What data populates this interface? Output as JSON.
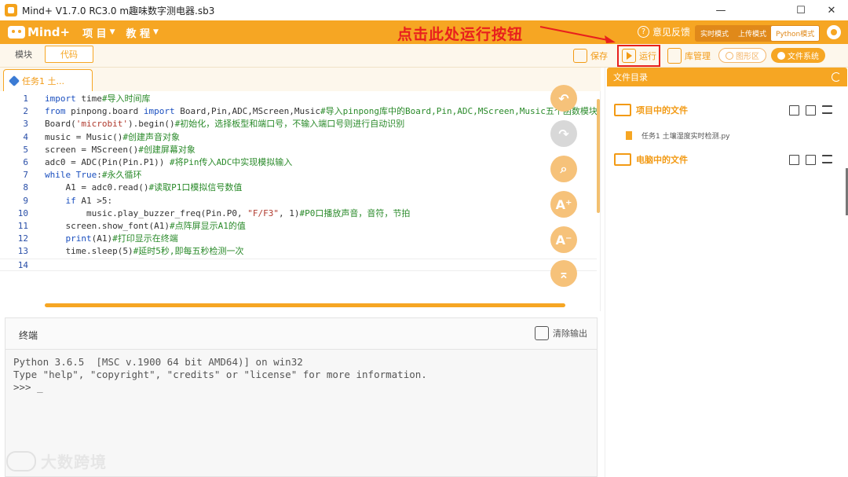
{
  "window": {
    "title": "Mind+ V1.7.0 RC3.0   m趣味数字测电器.sb3",
    "minimize": "—",
    "maximize": "☐",
    "close": "✕"
  },
  "menubar": {
    "logo": "Mind+",
    "menus": [
      {
        "label": "项 目",
        "caret": "▼"
      },
      {
        "label": "教 程",
        "caret": "▼"
      }
    ],
    "annotation": "点击此处运行按钮",
    "feedback": "意见反馈",
    "modes": [
      {
        "label": "实时模式",
        "active": false
      },
      {
        "label": "上传模式",
        "active": false
      },
      {
        "label": "Python模式",
        "active": true
      }
    ]
  },
  "toolbar": {
    "tabs": [
      {
        "label": "模块"
      },
      {
        "label": "代码"
      }
    ],
    "save": "保存",
    "run": "运行",
    "library": "库管理",
    "graph": "图形区",
    "filesystem": "文件系统"
  },
  "editor": {
    "file_tab": "任务1 土...",
    "lines": [
      {
        "n": "1",
        "text": "import time#导入时间库"
      },
      {
        "n": "2",
        "text": "from pinpong.board import Board,Pin,ADC,MScreen,Music#导入pinpong库中的Board,Pin,ADC,MScreen,Music五个函数模块"
      },
      {
        "n": "3",
        "text": "Board('microbit').begin()#初始化，选择板型和端口号，不输入端口号则进行自动识别"
      },
      {
        "n": "4",
        "text": "music = Music()#创建声音对象"
      },
      {
        "n": "5",
        "text": "screen = MScreen()#创建屏幕对象"
      },
      {
        "n": "6",
        "text": "adc0 = ADC(Pin(Pin.P1)) #将Pin传入ADC中实现模拟输入"
      },
      {
        "n": "7",
        "text": "while True:#永久循环"
      },
      {
        "n": "8",
        "text": "    A1 = adc0.read()#读取P1口模拟信号数值"
      },
      {
        "n": "9",
        "text": "    if A1 >5:"
      },
      {
        "n": "10",
        "text": "        music.play_buzzer_freq(Pin.P0, \"F/F3\", 1)#P0口播放声音，音符，节拍"
      },
      {
        "n": "11",
        "text": "    screen.show_font(A1)#点阵屏显示A1的值"
      },
      {
        "n": "12",
        "text": "    print(A1)#打印显示在终端"
      },
      {
        "n": "13",
        "text": "    time.sleep(5)#延时5秒,即每五秒检测一次"
      },
      {
        "n": "14",
        "text": ""
      }
    ],
    "side_buttons": [
      {
        "icon": "undo-icon",
        "glyph": "↶",
        "enabled": true
      },
      {
        "icon": "redo-icon",
        "glyph": "↷",
        "enabled": false
      },
      {
        "icon": "search-icon",
        "glyph": "⌕",
        "enabled": true
      },
      {
        "icon": "zoom-in-icon",
        "glyph": "A⁺",
        "enabled": true
      },
      {
        "icon": "zoom-out-icon",
        "glyph": "A⁻",
        "enabled": true
      },
      {
        "icon": "scroll-top-icon",
        "glyph": "⌅",
        "enabled": true
      }
    ]
  },
  "terminal": {
    "title": "终端",
    "clear": "清除输出",
    "output": "Python 3.6.5  [MSC v.1900 64 bit AMD64)] on win32\nType \"help\", \"copyright\", \"credits\" or \"license\" for more information.\n>>> _"
  },
  "watermark": "大数跨境",
  "file_panel": {
    "title": "文件目录",
    "project_files": "项目中的文件",
    "file_name": "任务1 土壤湿度实时检测.py",
    "computer_files": "电脑中的文件"
  },
  "colors": {
    "accent": "#f6a623",
    "annotation_red": "#e8201d"
  }
}
